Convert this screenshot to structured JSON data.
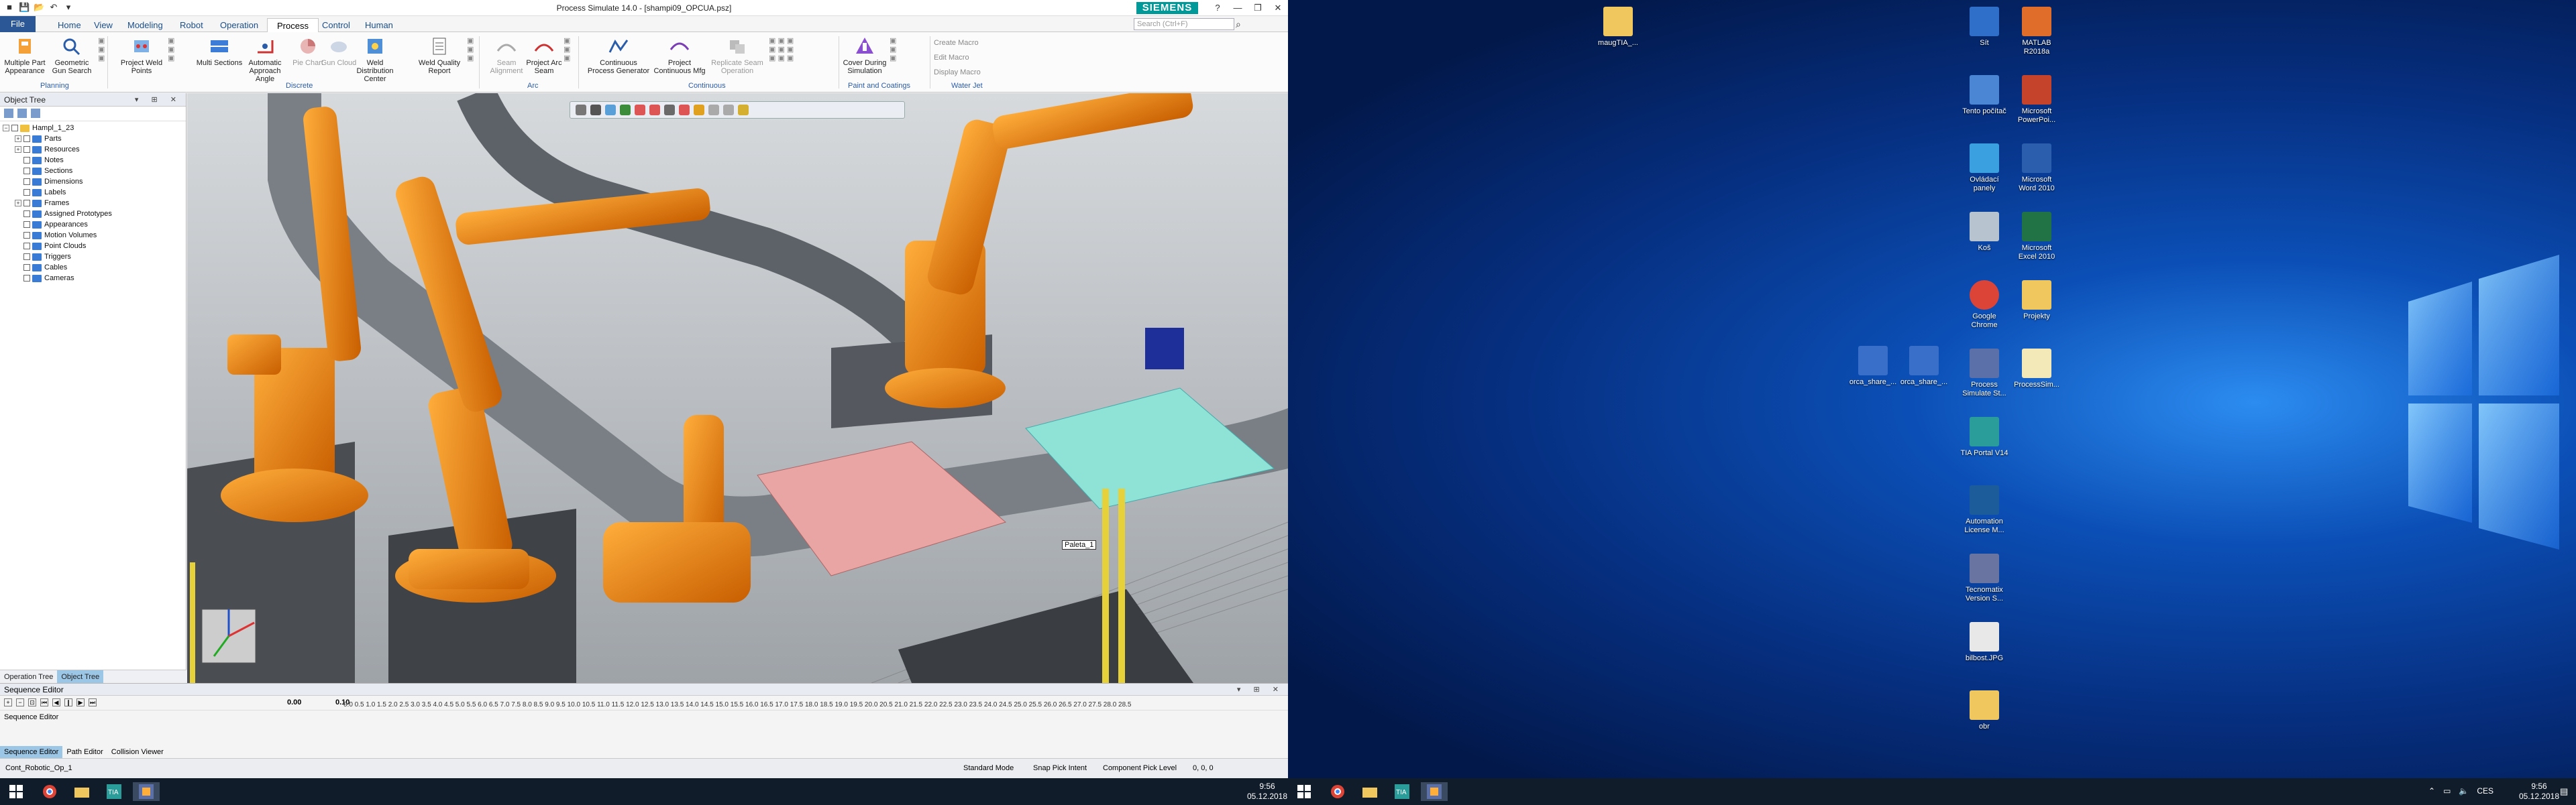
{
  "app": {
    "title": "Process Simulate 14.0 - [shampi09_OPCUA.psz]",
    "brand": "SIEMENS",
    "search_placeholder": "Search (Ctrl+F)"
  },
  "tabs": [
    "File",
    "Home",
    "View",
    "Modeling",
    "Robot",
    "Operation",
    "Process",
    "Control",
    "Human"
  ],
  "active_tab": "Process",
  "ribbon": {
    "buttons": [
      {
        "label": "Multiple Part Appearance",
        "icon": "part-appearance-icon",
        "enabled": true
      },
      {
        "label": "Geometric Gun Search",
        "icon": "gun-search-icon",
        "enabled": true
      },
      {
        "label": "Project Weld Points",
        "icon": "weld-points-icon",
        "enabled": true
      },
      {
        "label": "Multi Sections",
        "icon": "sections-icon",
        "enabled": true
      },
      {
        "label": "Automatic Approach Angle",
        "icon": "approach-angle-icon",
        "enabled": true
      },
      {
        "label": "Pie Chart",
        "icon": "pie-chart-icon",
        "enabled": false
      },
      {
        "label": "Gun Cloud",
        "icon": "gun-cloud-icon",
        "enabled": false
      },
      {
        "label": "Weld Distribution Center",
        "icon": "weld-center-icon",
        "enabled": true
      },
      {
        "label": "Weld Quality Report",
        "icon": "report-icon",
        "enabled": true
      },
      {
        "label": "Seam Alignment",
        "icon": "seam-align-icon",
        "enabled": false
      },
      {
        "label": "Project Arc Seam",
        "icon": "arc-seam-icon",
        "enabled": true
      },
      {
        "label": "Continuous Process Generator",
        "icon": "process-generator-icon",
        "enabled": true
      },
      {
        "label": "Project Continuous Mfg",
        "icon": "continuous-mfg-icon",
        "enabled": true
      },
      {
        "label": "Replicate Seam Operation",
        "icon": "replicate-icon",
        "enabled": false
      },
      {
        "label": "Cover During Simulation",
        "icon": "cover-icon",
        "enabled": true
      }
    ],
    "small_buttons": [
      "Create Macro",
      "Edit Macro",
      "Display Macro"
    ],
    "groups": [
      "Planning",
      "Discrete",
      "Arc",
      "Continuous",
      "Paint and Coatings",
      "Water Jet"
    ]
  },
  "object_tree": {
    "title": "Object Tree",
    "root": "Hampl_1_23",
    "items": [
      "Parts",
      "Resources",
      "Notes",
      "Sections",
      "Dimensions",
      "Labels",
      "Frames",
      "Assigned Prototypes",
      "Appearances",
      "Motion Volumes",
      "Point Clouds",
      "Triggers",
      "Cables",
      "Cameras"
    ],
    "bottom_tabs": [
      "Operation Tree",
      "Object Tree"
    ],
    "active_bottom_tab": "Object Tree"
  },
  "viewport": {
    "label": "Paleta_1"
  },
  "sequence_editor": {
    "title": "Sequence Editor",
    "time": "0.00",
    "step": "0.10",
    "ruler": "0.0 0.5 1.0 1.5 2.0 2.5 3.0 3.5 4.0 4.5 5.0 5.5 6.0 6.5 7.0 7.5 8.0 8.5 9.0 9.5 10.0 10.5 11.0 11.5 12.0 12.5 13.0 13.5 14.0 14.5 15.0 15.5 16.0 16.5 17.0 17.5 18.0 18.5 19.0 19.5 20.0 20.5 21.0 21.5 22.0 22.5 23.0 23.5 24.0 24.5 25.0 25.5 26.0 26.5 27.0 27.5 28.0 28.5",
    "row_label": "Sequence Editor",
    "tabs": [
      "Sequence Editor",
      "Path Editor",
      "Collision Viewer"
    ],
    "active_tab": "Sequence Editor"
  },
  "status_bar": {
    "operation": "Cont_Robotic_Op_1",
    "mode": "Standard Mode",
    "snap": "Snap Pick Intent",
    "pick_level": "Component Pick Level",
    "coords": "0, 0, 0"
  },
  "taskbar": {
    "time": "9:56",
    "date": "05.12.2018",
    "language": "CES"
  },
  "desktop_icons": [
    {
      "label": "Sít",
      "color": "#2f6fc9"
    },
    {
      "label": "Tento počítač",
      "color": "#4a86d4"
    },
    {
      "label": "Ovládací panely",
      "color": "#3ba0e0"
    },
    {
      "label": "Koš",
      "color": "#b7c3cf"
    },
    {
      "label": "Google Chrome",
      "color": "#db4437"
    },
    {
      "label": "Process Simulate St...",
      "color": "#5b6fa8"
    },
    {
      "label": "TIA Portal V14",
      "color": "#2a9d9a"
    },
    {
      "label": "Automation License M...",
      "color": "#1d5c9b"
    },
    {
      "label": "Tecnomatix Version S...",
      "color": "#6a74a0"
    },
    {
      "label": "bilbost.JPG",
      "color": "#e8e8e8"
    },
    {
      "label": "obr",
      "color": "#f0c75e"
    },
    {
      "label": "MATLAB R2018a",
      "color": "#e16d2a"
    },
    {
      "label": "Microsoft PowerPoi...",
      "color": "#c4432a"
    },
    {
      "label": "Microsoft Word 2010",
      "color": "#2b5fae"
    },
    {
      "label": "Microsoft Excel 2010",
      "color": "#217346"
    },
    {
      "label": "Projekty",
      "color": "#f0c75e"
    },
    {
      "label": "ProcessSim...",
      "color": "#f3e9b8"
    },
    {
      "label": "maugTIA_...",
      "color": "#f0c75e"
    },
    {
      "label": "orca_share_...",
      "color": "#3a6fc9"
    },
    {
      "label": "orca_share_...",
      "color": "#3a6fc9"
    }
  ]
}
